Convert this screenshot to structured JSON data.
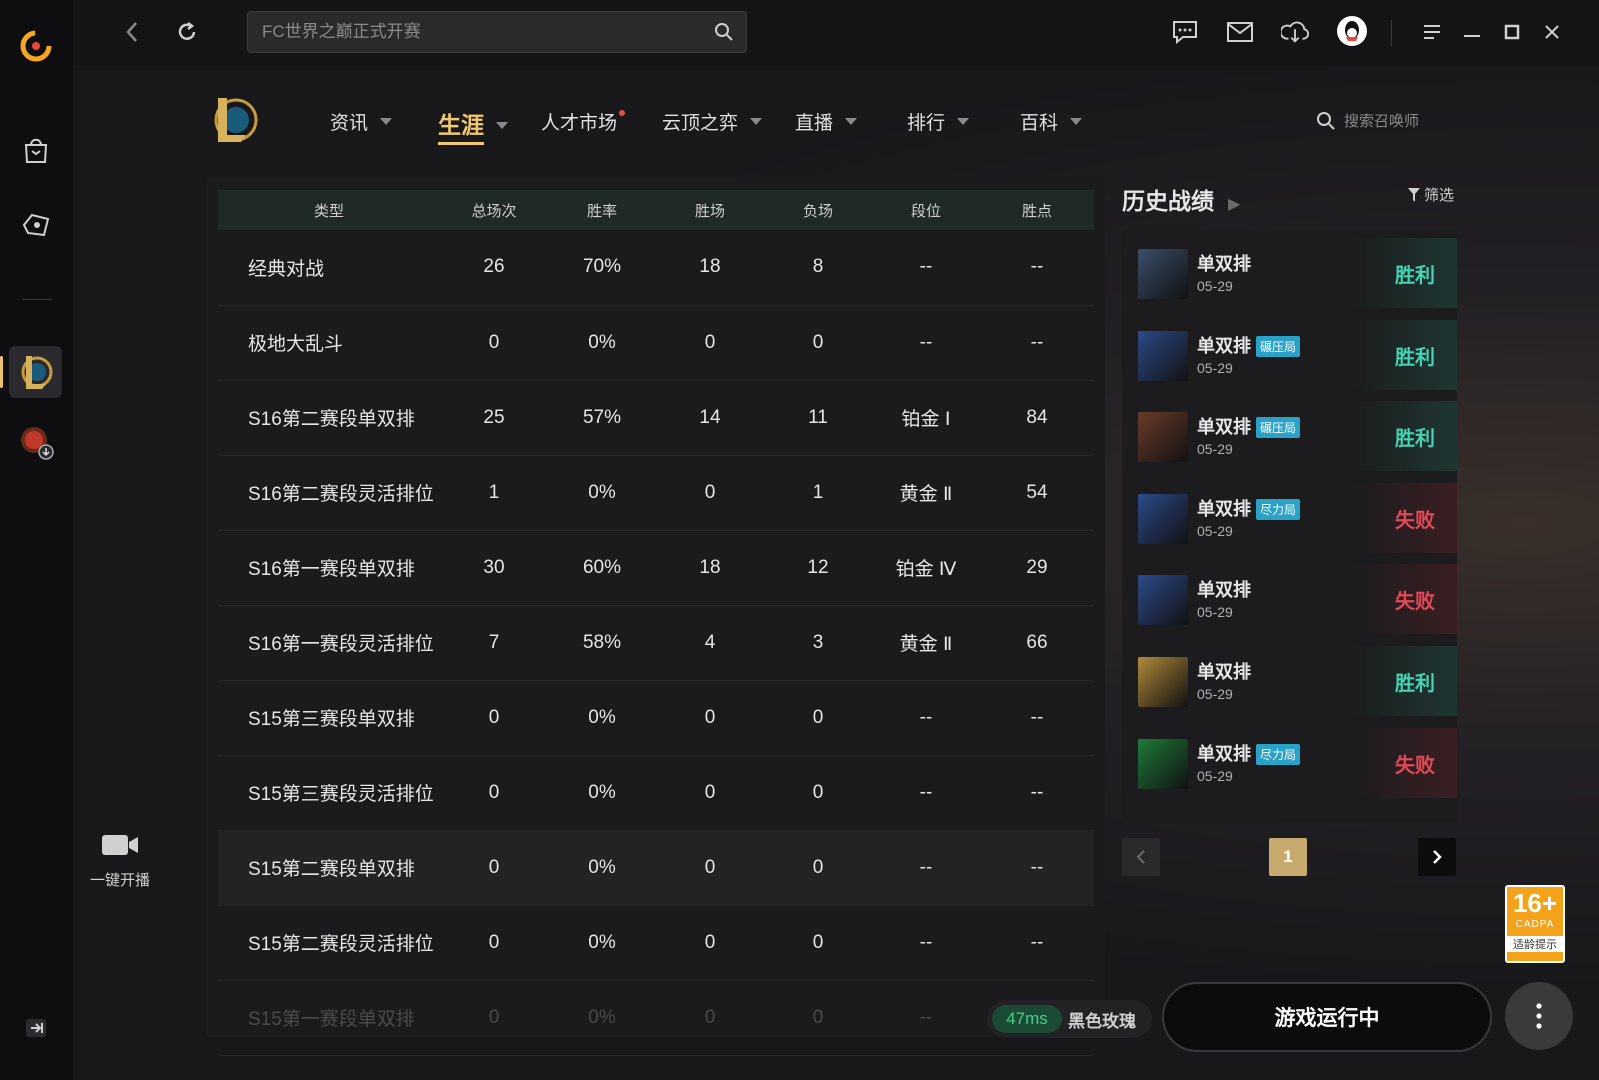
{
  "app": {
    "search_placeholder": "FC世界之巅正式开赛"
  },
  "sidebar": {
    "live_label": "一键开播"
  },
  "nav": {
    "items": [
      "资讯",
      "生涯",
      "人才市场",
      "云顶之弈",
      "直播",
      "排行",
      "百科"
    ],
    "active": "生涯",
    "summoner_search_placeholder": "搜索召唤师"
  },
  "stats_table": {
    "headers": [
      "类型",
      "总场次",
      "胜率",
      "胜场",
      "负场",
      "段位",
      "胜点"
    ],
    "rows": [
      [
        "经典对战",
        "26",
        "70%",
        "18",
        "8",
        "--",
        "--"
      ],
      [
        "极地大乱斗",
        "0",
        "0%",
        "0",
        "0",
        "--",
        "--"
      ],
      [
        "S16第二赛段单双排",
        "25",
        "57%",
        "14",
        "11",
        "铂金 Ⅰ",
        "84"
      ],
      [
        "S16第二赛段灵活排位",
        "1",
        "0%",
        "0",
        "1",
        "黄金 Ⅱ",
        "54"
      ],
      [
        "S16第一赛段单双排",
        "30",
        "60%",
        "18",
        "12",
        "铂金 Ⅳ",
        "29"
      ],
      [
        "S16第一赛段灵活排位",
        "7",
        "58%",
        "4",
        "3",
        "黄金 Ⅱ",
        "66"
      ],
      [
        "S15第三赛段单双排",
        "0",
        "0%",
        "0",
        "0",
        "--",
        "--"
      ],
      [
        "S15第三赛段灵活排位",
        "0",
        "0%",
        "0",
        "0",
        "--",
        "--"
      ],
      [
        "S15第二赛段单双排",
        "0",
        "0%",
        "0",
        "0",
        "--",
        "--"
      ],
      [
        "S15第二赛段灵活排位",
        "0",
        "0%",
        "0",
        "0",
        "--",
        "--"
      ],
      [
        "S15第一赛段单双排",
        "0",
        "0%",
        "0",
        "0",
        "--",
        "--"
      ]
    ]
  },
  "history": {
    "title": "历史战绩",
    "filter_label": "筛选",
    "matches": [
      {
        "mode": "单双排",
        "tag": "",
        "date": "05-29",
        "result": "胜利",
        "win": true,
        "avatar_color": "#3b4f6a"
      },
      {
        "mode": "单双排",
        "tag": "碾压局",
        "date": "05-29",
        "result": "胜利",
        "win": true,
        "avatar_color": "#2c4a8a"
      },
      {
        "mode": "单双排",
        "tag": "碾压局",
        "date": "05-29",
        "result": "胜利",
        "win": true,
        "avatar_color": "#6a3a2a"
      },
      {
        "mode": "单双排",
        "tag": "尽力局",
        "date": "05-29",
        "result": "失败",
        "win": false,
        "avatar_color": "#2c4a8a"
      },
      {
        "mode": "单双排",
        "tag": "",
        "date": "05-29",
        "result": "失败",
        "win": false,
        "avatar_color": "#2c4a8a"
      },
      {
        "mode": "单双排",
        "tag": "",
        "date": "05-29",
        "result": "胜利",
        "win": true,
        "avatar_color": "#b08a3a"
      },
      {
        "mode": "单双排",
        "tag": "尽力局",
        "date": "05-29",
        "result": "失败",
        "win": false,
        "avatar_color": "#1f7a3a"
      }
    ],
    "current_page": "1"
  },
  "bottom": {
    "ping": "47ms",
    "server": "黑色玫瑰",
    "run_button": "游戏运行中"
  },
  "age_badge": {
    "rating": "16+",
    "org": "CADPA",
    "label": "适龄提示"
  },
  "colors": {
    "accent_gold": "#f0c870",
    "win": "#45d3b3",
    "lose": "#e14a56",
    "tag_blue": "#2aa2c8"
  }
}
